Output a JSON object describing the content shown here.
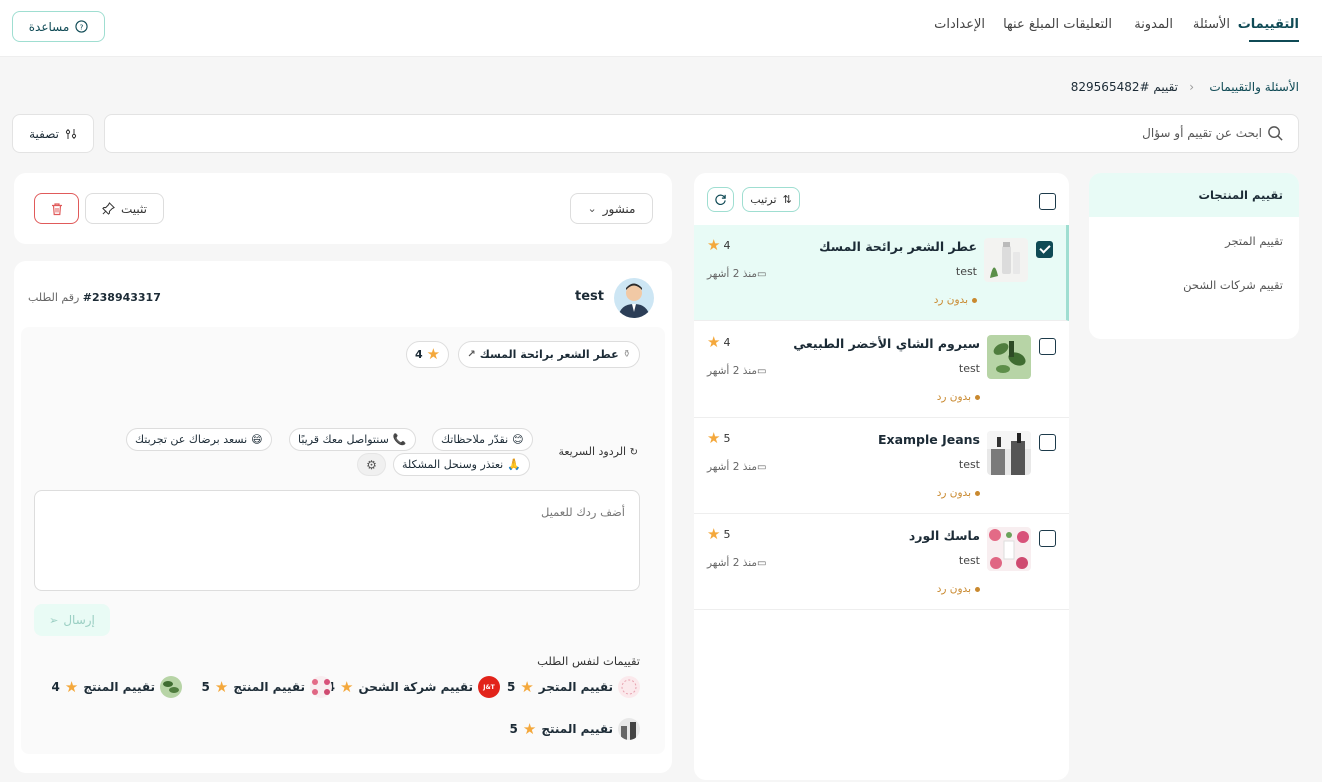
{
  "nav": {
    "tabs": [
      "التقييمات",
      "الأسئلة",
      "المدونة",
      "التعليقات المبلغ عنها",
      "الإعدادات"
    ],
    "help_label": "مساعدة"
  },
  "breadcrumb": {
    "parent": "الأسئلة والتقييمات",
    "current": "تقييم #829565482"
  },
  "search": {
    "placeholder": "ابحث عن تقييم أو سؤال",
    "filter_label": "تصفية"
  },
  "sidebar": {
    "items": [
      "تقييم المنتجات",
      "تقييم المتجر",
      "تقييم شركات الشحن"
    ]
  },
  "list": {
    "sort_label": "ترتيب",
    "items": [
      {
        "title": "عطر الشعر برائحة المسك",
        "customer": "test",
        "status": "بدون رد",
        "time": "منذ 2 أشهر",
        "rating": "4"
      },
      {
        "title": "سيروم الشاي الأخضر الطبيعي",
        "customer": "test",
        "status": "بدون رد",
        "time": "منذ 2 أشهر",
        "rating": "4"
      },
      {
        "title": "Example Jeans",
        "customer": "test",
        "status": "بدون رد",
        "time": "منذ 2 أشهر",
        "rating": "5"
      },
      {
        "title": "ماسك الورد",
        "customer": "test",
        "status": "بدون رد",
        "time": "منذ 2 أشهر",
        "rating": "5"
      }
    ]
  },
  "toolbar": {
    "status_select": "منشور",
    "pin_label": "تثبيت"
  },
  "detail": {
    "customer_name": "test",
    "order_label": "رقم الطلب",
    "order_number": "#238943317",
    "product_name": "عطر الشعر برائحة المسك",
    "rating": "4",
    "quick_replies_label": "الردود السريعة",
    "quick_replies": [
      "نقدّر ملاحظاتك",
      "سنتواصل معك قريبًا",
      "نسعد برضاك عن تجربتك",
      "نعتذر وسنحل المشكلة"
    ],
    "reply_placeholder": "أضف ردك للعميل",
    "send_label": "إرسال",
    "same_order_label": "تقييمات لنفس الطلب",
    "same_order": [
      {
        "label": "تقييم المتجر",
        "rating": "5"
      },
      {
        "label": "تقييم شركة الشحن",
        "rating": "4"
      },
      {
        "label": "تقييم المنتج",
        "rating": "5"
      },
      {
        "label": "تقييم المنتج",
        "rating": "4"
      },
      {
        "label": "تقييم المنتج",
        "rating": "5"
      }
    ]
  },
  "colors": {
    "accent": "#0f4a55",
    "mint": "#e8fbf6",
    "star": "#f4a83c",
    "status": "#c9892f",
    "danger": "#e05a5a"
  }
}
